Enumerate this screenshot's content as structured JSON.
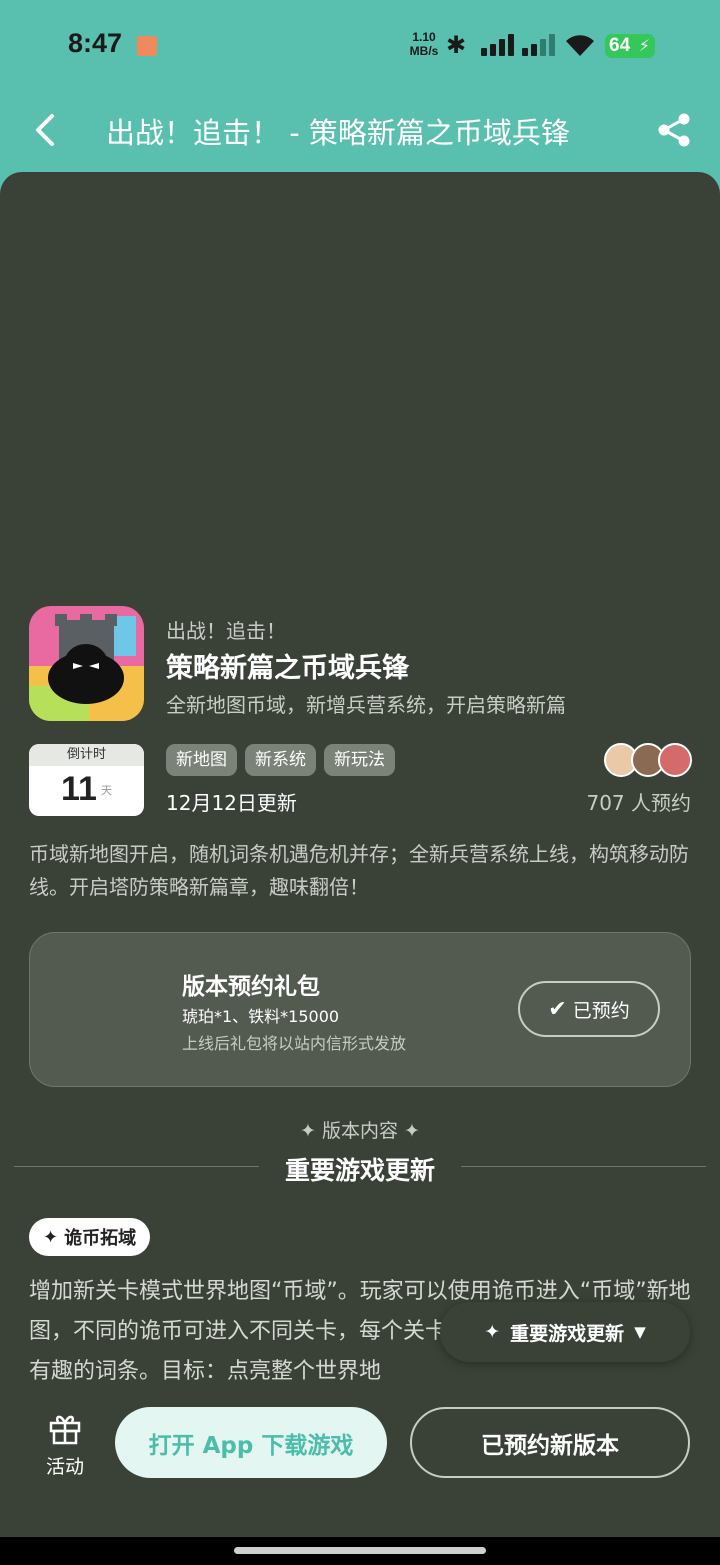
{
  "status_bar": {
    "time": "8:47",
    "net_speed_value": "1.10",
    "net_speed_unit": "MB/s",
    "battery": "64"
  },
  "header": {
    "title": "出战！追击！ - 策略新篇之币域兵锋"
  },
  "game": {
    "subtitle": "出战！追击！",
    "title": "策略新篇之币域兵锋",
    "description": "全新地图币域，新增兵营系统，开启策略新篇"
  },
  "countdown": {
    "label": "倒计时",
    "days": "11",
    "unit": "天"
  },
  "tags": [
    "新地图",
    "新系统",
    "新玩法"
  ],
  "update_date": "12月12日更新",
  "reserve_count": "707 人预约",
  "intro": "币域新地图开启，随机词条机遇危机并存；全新兵营系统上线，构筑移动防线。开启塔防策略新篇章，趣味翻倍！",
  "gift": {
    "title": "版本预约礼包",
    "items": "琥珀*1、铁料*15000",
    "note": "上线后礼包将以站内信形式发放",
    "button_label": "已预约"
  },
  "section": {
    "kicker": "✦ 版本内容 ✦",
    "title": "重要游戏更新"
  },
  "feature": {
    "chip_label": "诡币拓域",
    "body": "增加新关卡模式世界地图“币域”。玩家可以使用诡币进入“币域”新地图，不同的诡币可进入不同关卡，每个关卡难有度会被随机赋予一些有趣的词条。目标：点亮整个世界地"
  },
  "floating_nav": {
    "label": "重要游戏更新"
  },
  "bottom_bar": {
    "activity_label": "活动",
    "open_app_label": "打开 App 下载游戏",
    "reserved_new_label": "已预约新版本"
  },
  "colors": {
    "header_bg": "#59bfae",
    "sheet_bg": "#3a4238",
    "accent": "#4cbcab"
  }
}
